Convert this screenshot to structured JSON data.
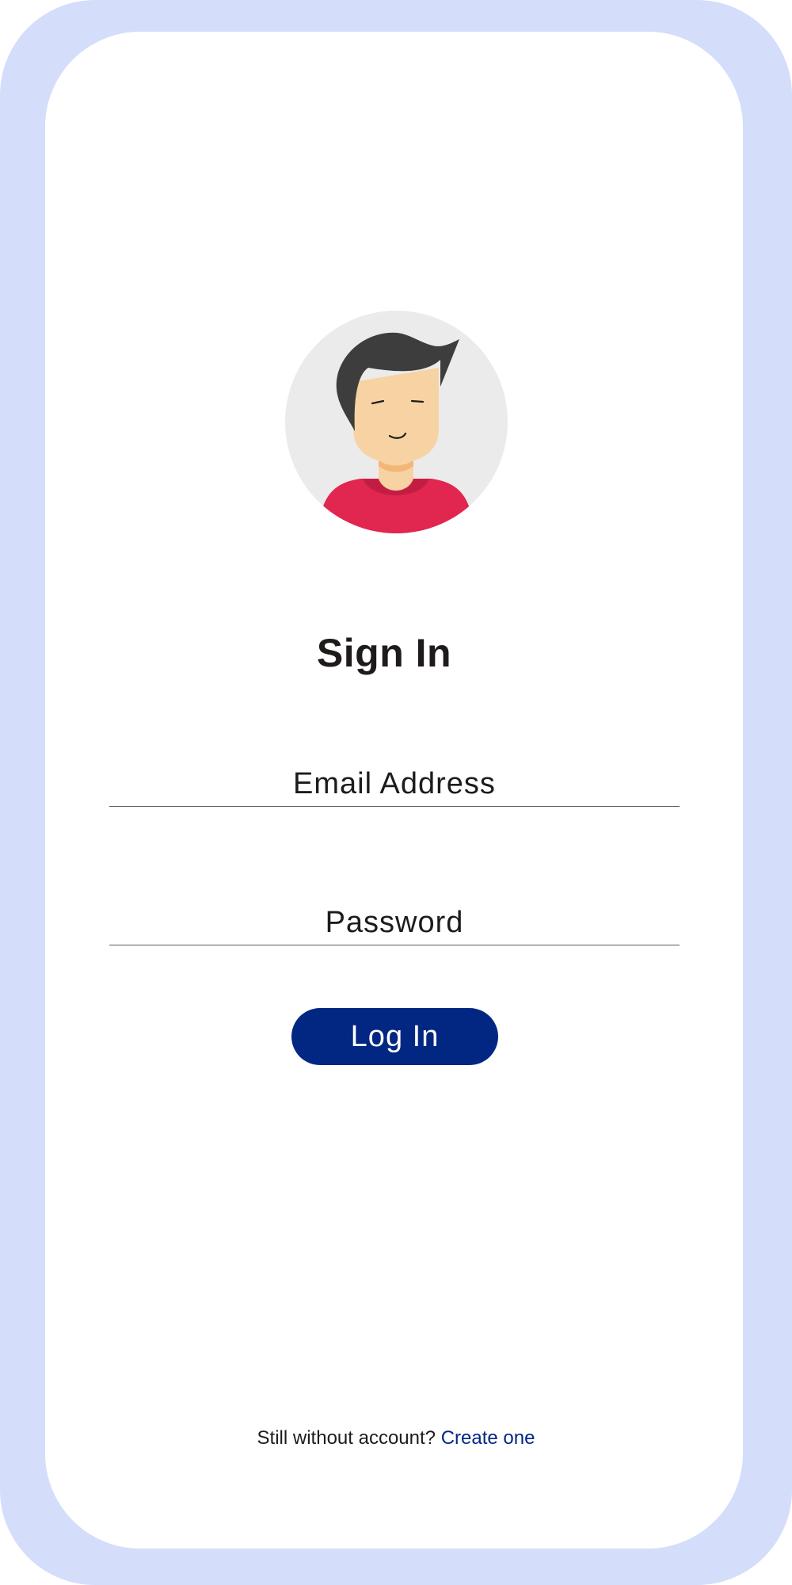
{
  "colors": {
    "frame": "#d4defa",
    "screen": "#ffffff",
    "accent": "#022782",
    "text": "#1f1b1b"
  },
  "avatar": {
    "icon": "user-avatar-icon"
  },
  "signin": {
    "title": "Sign In",
    "email_placeholder": "Email Address",
    "email_value": "",
    "password_placeholder": "Password",
    "password_value": "",
    "login_label": "Log In"
  },
  "footer": {
    "prompt": "Still without account?",
    "link": "Create one"
  }
}
